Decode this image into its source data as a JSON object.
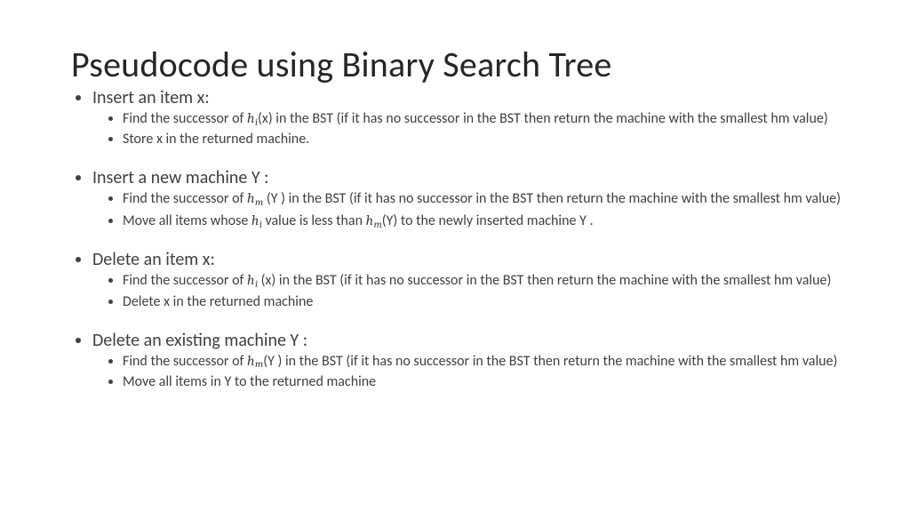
{
  "title": "Pseudocode using Binary Search Tree",
  "sections": [
    {
      "heading": "Insert an item x:",
      "bullets": [
        {
          "pre": "Find the successor of ",
          "var": "h",
          "sub": "i",
          "post": "(x) in the BST (if it has no successor in the BST then return the machine with the smallest hm value)"
        },
        {
          "pre": "Store x in the returned machine."
        }
      ]
    },
    {
      "heading": "Insert a new machine Y :",
      "bullets": [
        {
          "pre": "Find the successor of  ",
          "var": "h",
          "sub": "m",
          "post": " (Y ) in the BST (if it has no successor in the BST then return the machine with the smallest hm value)"
        },
        {
          "pre": " Move all items whose  ",
          "var": "h",
          "sub": "i",
          "mid": " value is less than ",
          "var2": "h",
          "sub2": "m",
          "post": "(Y) to the newly inserted machine Y ."
        }
      ]
    },
    {
      "heading": "Delete an item x:",
      "bullets": [
        {
          "pre": "Find the successor of  ",
          "var": "h",
          "sub": "i",
          "post": " (x) in the BST (if it has no successor in the BST then return the machine with the smallest hm value)"
        },
        {
          "pre": " Delete x in the returned machine"
        }
      ]
    },
    {
      "heading": "Delete an existing machine Y :",
      "bullets": [
        {
          "pre": " Find the successor of ",
          "var": "h",
          "sub": "m",
          "post": "(Y ) in the BST (if it has no successor in the BST then return the machine with the smallest hm value)"
        },
        {
          "pre": " Move all items in Y to the returned machine"
        }
      ]
    }
  ]
}
